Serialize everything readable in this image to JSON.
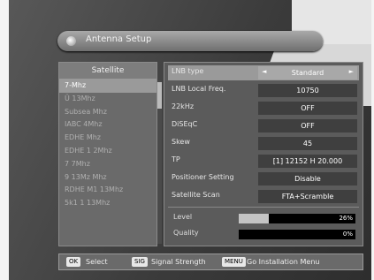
{
  "title": "Antenna Setup",
  "satellite_list": {
    "header": "Satellite",
    "items": [
      "7-Mhz",
      "Ü 13Mhz",
      "Subsea Mhz",
      "IABC 4Mhz",
      "EDHE Mhz",
      "EDHE 1 2Mhz",
      "7 7Mhz",
      "9 13Mz Mhz",
      "RDHE M1 13Mhz",
      "5k1 1 13Mhz"
    ],
    "selected_index": 0
  },
  "settings": [
    {
      "label": "LNB type",
      "value": "Standard",
      "selected": true
    },
    {
      "label": "LNB Local Freq.",
      "value": "10750",
      "selected": false
    },
    {
      "label": "22kHz",
      "value": "OFF",
      "selected": false
    },
    {
      "label": "DiSEqC",
      "value": "OFF",
      "selected": false
    },
    {
      "label": "Skew",
      "value": "45",
      "selected": false
    },
    {
      "label": "TP",
      "value": "[1] 12152 H 20.000",
      "selected": false
    },
    {
      "label": "Positioner Setting",
      "value": "Disable",
      "selected": false
    },
    {
      "label": "Satellite Scan",
      "value": "FTA+Scramble",
      "selected": false
    }
  ],
  "meters": {
    "level_label": "Level",
    "level_value": 26,
    "level_text": "26%",
    "quality_label": "Quality",
    "quality_value": 0,
    "quality_text": "0%"
  },
  "help": {
    "ok_key": "OK",
    "ok_text": "Select",
    "sig_key": "SIG",
    "sig_text": "Signal Strength",
    "menu_key": "MENU",
    "menu_text": "Go Installation Menu"
  }
}
